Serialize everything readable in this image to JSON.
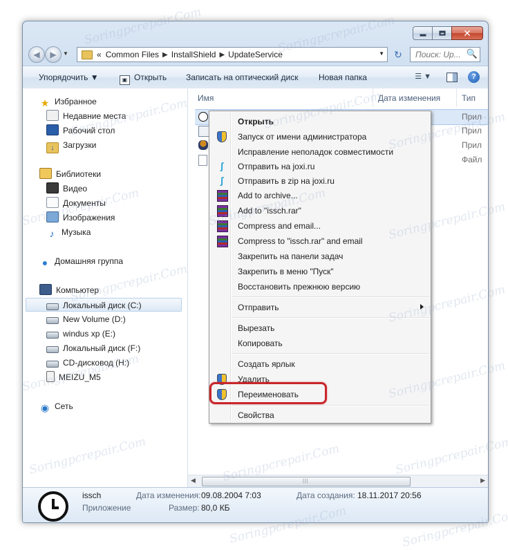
{
  "window": {
    "caption_buttons": {
      "min_icon": "minimize-icon",
      "max_icon": "maximize-icon",
      "close_glyph": "✕"
    }
  },
  "address_bar": {
    "prefix": "«",
    "crumbs": [
      "Common Files",
      "InstallShield",
      "UpdateService"
    ],
    "separator": "▶",
    "dropdown": "▼",
    "refresh_glyph": "↻"
  },
  "search": {
    "placeholder": "Поиск: Up...",
    "icon": "🔍"
  },
  "toolbar": {
    "organize": "Упорядочить ▼",
    "open": "Открыть",
    "burn": "Записать на оптический диск",
    "new_folder": "Новая папка",
    "views": "▼",
    "help": "?"
  },
  "nav": {
    "favorites": "Избранное",
    "recent": "Недавние места",
    "desktop": "Рабочий стол",
    "downloads": "Загрузки",
    "libraries": "Библиотеки",
    "video": "Видео",
    "documents": "Документы",
    "images": "Изображения",
    "music": "Музыка",
    "homegroup": "Домашняя группа",
    "computer": "Компьютер",
    "drive_c": "Локальный диск (C:)",
    "drive_d": "New Volume (D:)",
    "drive_e": "windus xp (E:)",
    "drive_f": "Локальный диск (F:)",
    "drive_h": "CD-дисковод (H:)",
    "meizu": "MEIZU_M5",
    "network": "Сеть"
  },
  "columns": {
    "name": "Имя",
    "modified": "Дата изменения",
    "type": "Тип"
  },
  "files": [
    {
      "type": "Прил"
    },
    {
      "type": "Прил"
    },
    {
      "type": "Прил"
    },
    {
      "type": "Файл"
    }
  ],
  "context_menu": {
    "open": "Открыть",
    "run_as_admin": "Запуск от имени администратора",
    "troubleshoot": "Исправление неполадок совместимости",
    "send_joxi": "Отправить на joxi.ru",
    "send_zip_joxi": "Отправить в zip на joxi.ru",
    "add_archive": "Add to archive...",
    "add_rar": "Add to \"issch.rar\"",
    "compress_email": "Compress and email...",
    "compress_rar_email": "Compress to \"issch.rar\" and email",
    "pin_taskbar": "Закрепить на панели задач",
    "pin_start": "Закрепить в меню \"Пуск\"",
    "restore": "Восстановить прежнюю версию",
    "send_to": "Отправить",
    "cut": "Вырезать",
    "copy": "Копировать",
    "shortcut": "Создать ярлык",
    "delete": "Удалить",
    "rename": "Переименовать",
    "properties": "Свойства"
  },
  "details": {
    "name": "issch",
    "kind": "Приложение",
    "modified_label": "Дата изменения:",
    "modified_value": "09.08.2004 7:03",
    "size_label": "Размер:",
    "size_value": "80,0 КБ",
    "created_label": "Дата создания:",
    "created_value": "18.11.2017 20:56"
  },
  "watermark": "Soringpcrepair.Com",
  "colors": {
    "highlight_border": "#c8252a",
    "selection": "#dbe8f8"
  }
}
